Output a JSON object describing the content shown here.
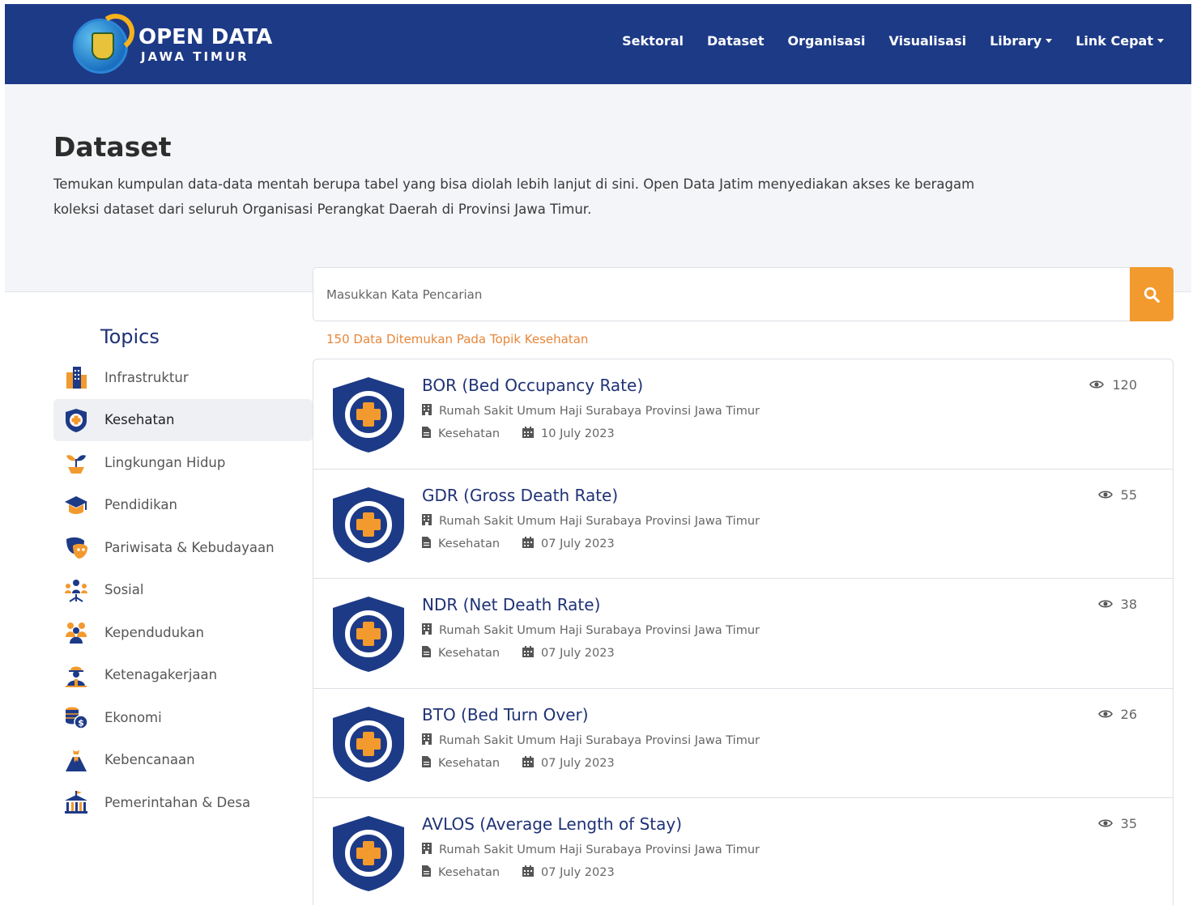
{
  "header": {
    "logo_title": "OPEN DATA",
    "logo_subtitle": "JAWA TIMUR",
    "nav": [
      {
        "label": "Sektoral",
        "dropdown": false
      },
      {
        "label": "Dataset",
        "dropdown": false
      },
      {
        "label": "Organisasi",
        "dropdown": false
      },
      {
        "label": "Visualisasi",
        "dropdown": false
      },
      {
        "label": "Library",
        "dropdown": true
      },
      {
        "label": "Link Cepat",
        "dropdown": true
      }
    ]
  },
  "hero": {
    "title": "Dataset",
    "description": "Temukan kumpulan data-data mentah berupa tabel yang bisa diolah lebih lanjut di sini. Open Data Jatim menyediakan akses ke beragam koleksi dataset dari seluruh Organisasi Perangkat Daerah di Provinsi Jawa Timur."
  },
  "search": {
    "placeholder": "Masukkan Kata Pencarian",
    "value": ""
  },
  "result_count": "150 Data Ditemukan Pada Topik Kesehatan",
  "sidebar": {
    "title": "Topics",
    "items": [
      {
        "label": "Infrastruktur",
        "icon": "building-icon",
        "active": false
      },
      {
        "label": "Kesehatan",
        "icon": "health-shield-icon",
        "active": true
      },
      {
        "label": "Lingkungan Hidup",
        "icon": "plant-icon",
        "active": false
      },
      {
        "label": "Pendidikan",
        "icon": "graduation-cap-icon",
        "active": false
      },
      {
        "label": "Pariwisata & Kebudayaan",
        "icon": "mask-icon",
        "active": false
      },
      {
        "label": "Sosial",
        "icon": "people-network-icon",
        "active": false
      },
      {
        "label": "Kependudukan",
        "icon": "population-icon",
        "active": false
      },
      {
        "label": "Ketenagakerjaan",
        "icon": "worker-icon",
        "active": false
      },
      {
        "label": "Ekonomi",
        "icon": "coins-icon",
        "active": false
      },
      {
        "label": "Kebencanaan",
        "icon": "volcano-icon",
        "active": false
      },
      {
        "label": "Pemerintahan & Desa",
        "icon": "government-building-icon",
        "active": false
      }
    ]
  },
  "datasets": [
    {
      "title": "BOR (Bed Occupancy Rate)",
      "organization": "Rumah Sakit Umum Haji Surabaya Provinsi Jawa Timur",
      "topic": "Kesehatan",
      "date": "10 July 2023",
      "views": "120"
    },
    {
      "title": "GDR (Gross Death Rate)",
      "organization": "Rumah Sakit Umum Haji Surabaya Provinsi Jawa Timur",
      "topic": "Kesehatan",
      "date": "07 July 2023",
      "views": "55"
    },
    {
      "title": "NDR (Net Death Rate)",
      "organization": "Rumah Sakit Umum Haji Surabaya Provinsi Jawa Timur",
      "topic": "Kesehatan",
      "date": "07 July 2023",
      "views": "38"
    },
    {
      "title": "BTO (Bed Turn Over)",
      "organization": "Rumah Sakit Umum Haji Surabaya Provinsi Jawa Timur",
      "topic": "Kesehatan",
      "date": "07 July 2023",
      "views": "26"
    },
    {
      "title": "AVLOS (Average Length of Stay)",
      "organization": "Rumah Sakit Umum Haji Surabaya Provinsi Jawa Timur",
      "topic": "Kesehatan",
      "date": "07 July 2023",
      "views": "35"
    }
  ],
  "colors": {
    "navbar": "#1d3a87",
    "accent": "#f29a2e",
    "result_count": "#e7873b",
    "title": "#1f3276"
  }
}
